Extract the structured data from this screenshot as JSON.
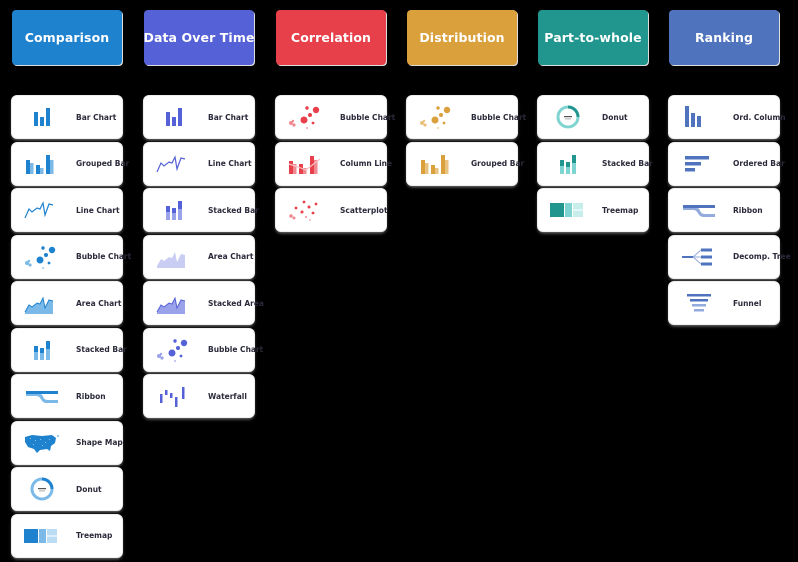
{
  "columns": [
    {
      "id": "comparison",
      "title": "Comparison",
      "color": "#1e82cf",
      "light": "#7bb9e8",
      "pale": "#bcdcf4",
      "items": [
        {
          "label": "Bar Chart",
          "icon": "bar"
        },
        {
          "label": "Grouped Bar",
          "icon": "grouped"
        },
        {
          "label": "Line Chart",
          "icon": "line"
        },
        {
          "label": "Bubble Chart",
          "icon": "bubble"
        },
        {
          "label": "Area Chart",
          "icon": "area"
        },
        {
          "label": "Stacked Bar",
          "icon": "stacked"
        },
        {
          "label": "Ribbon",
          "icon": "ribbon"
        },
        {
          "label": "Shape Map",
          "icon": "map"
        },
        {
          "label": "Donut",
          "icon": "donut"
        },
        {
          "label": "Treemap",
          "icon": "treemap"
        }
      ]
    },
    {
      "id": "data-over-time",
      "title": "Data Over Time",
      "color": "#5561d6",
      "light": "#9aa2ea",
      "pale": "#c9cdf4",
      "items": [
        {
          "label": "Bar Chart",
          "icon": "bar"
        },
        {
          "label": "Line Chart",
          "icon": "line"
        },
        {
          "label": "Stacked Bar",
          "icon": "stacked"
        },
        {
          "label": "Area Chart",
          "icon": "area-light"
        },
        {
          "label": "Stacked Area",
          "icon": "area"
        },
        {
          "label": "Bubble Chart",
          "icon": "bubble"
        },
        {
          "label": "Waterfall",
          "icon": "waterfall"
        }
      ]
    },
    {
      "id": "correlation",
      "title": "Correlation",
      "color": "#e8404a",
      "light": "#f08a90",
      "pale": "#f7c2c5",
      "items": [
        {
          "label": "Bubble Chart",
          "icon": "bubble"
        },
        {
          "label": "Column Line",
          "icon": "columnline"
        },
        {
          "label": "Scatterplot",
          "icon": "scatter"
        }
      ]
    },
    {
      "id": "distribution",
      "title": "Distribution",
      "color": "#d9a03c",
      "light": "#e9c27f",
      "pale": "#f3e0bd",
      "items": [
        {
          "label": "Bubble Chart",
          "icon": "bubble"
        },
        {
          "label": "Grouped Bar",
          "icon": "grouped"
        }
      ]
    },
    {
      "id": "part-to-whole",
      "title": "Part-to-whole",
      "color": "#21968e",
      "light": "#7fd3d0",
      "pale": "#c8eeec",
      "items": [
        {
          "label": "Donut",
          "icon": "donut"
        },
        {
          "label": "Stacked Bar",
          "icon": "stacked"
        },
        {
          "label": "Treemap",
          "icon": "treemap"
        }
      ]
    },
    {
      "id": "ranking",
      "title": "Ranking",
      "color": "#4f73bd",
      "light": "#93abdc",
      "pale": "#c6d4ee",
      "items": [
        {
          "label": "Ord. Column",
          "icon": "ordcol"
        },
        {
          "label": "Ordered Bar",
          "icon": "ordbar"
        },
        {
          "label": "Ribbon",
          "icon": "ribbon"
        },
        {
          "label": "Decomp. Tree",
          "icon": "decomp"
        },
        {
          "label": "Funnel",
          "icon": "funnel"
        }
      ]
    }
  ]
}
